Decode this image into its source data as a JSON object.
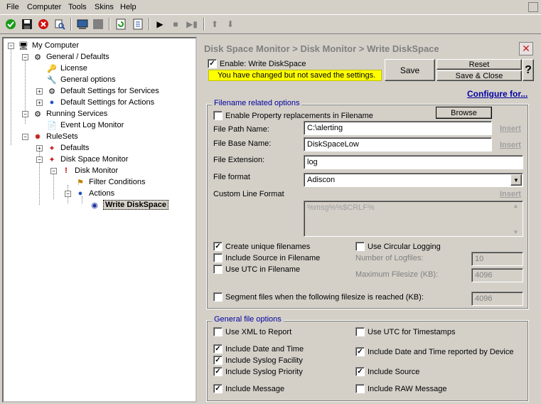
{
  "menu": [
    "File",
    "Computer",
    "Tools",
    "Skins",
    "Help"
  ],
  "tree": {
    "my_computer": "My Computer",
    "general_defaults": "General / Defaults",
    "license": "License",
    "general_options": "General options",
    "default_services": "Default Settings for Services",
    "default_actions": "Default Settings for Actions",
    "running_services": "Running Services",
    "event_log_monitor": "Event Log Monitor",
    "rulesets": "RuleSets",
    "defaults": "Defaults",
    "disk_space_monitor": "Disk Space Monitor",
    "disk_monitor": "Disk Monitor",
    "filter_conditions": "Filter Conditions",
    "actions": "Actions",
    "write_diskspace": "Write DiskSpace"
  },
  "panel": {
    "breadcrumb": "Disk Space Monitor  > Disk Monitor  > Write DiskSpace",
    "enable_label": "Enable: Write DiskSpace",
    "warning": "You have changed but not saved the settings.",
    "save": "Save",
    "reset": "Reset",
    "save_close": "Save & Close",
    "help": "?",
    "configure_for": "Configure for..."
  },
  "filename_group": {
    "title": "Filename related options",
    "enable_property": "Enable Property replacements in Filename",
    "browse": "Browse",
    "file_path_label": "File Path Name:",
    "file_path_value": "C:\\alerting",
    "file_base_label": "File Base Name:",
    "file_base_value": "DiskSpaceLow",
    "file_ext_label": "File Extension:",
    "file_ext_value": "log",
    "file_format_label": "File format",
    "file_format_value": "Adiscon",
    "custom_line_label": "Custom Line Format",
    "custom_line_value": "%msg%%$CRLF%",
    "insert": "Insert",
    "create_unique": "Create unique filenames",
    "include_source_fn": "Include Source in Filename",
    "use_utc_fn": "Use UTC in Filename",
    "use_circular": "Use Circular Logging",
    "num_logfiles_label": "Number of Logfiles:",
    "num_logfiles_value": "10",
    "max_filesize_label": "Maximum Filesize (KB):",
    "max_filesize_value": "4096",
    "segment_label": "Segment files when the following filesize is reached (KB):",
    "segment_value": "4096"
  },
  "general_group": {
    "title": "General file options",
    "use_xml": "Use XML to Report",
    "use_utc_ts": "Use UTC for Timestamps",
    "include_date": "Include Date and Time",
    "include_date_device": "Include Date and Time reported by Device",
    "include_facility": "Include Syslog Facility",
    "include_priority": "Include Syslog Priority",
    "include_source": "Include Source",
    "include_message": "Include Message",
    "include_raw": "Include RAW Message"
  },
  "colors": {
    "warning_bg": "#ffff00",
    "link": "#0000a0",
    "selected": "#000080"
  }
}
